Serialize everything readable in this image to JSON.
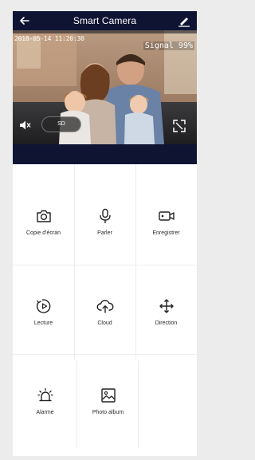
{
  "header": {
    "title": "Smart Camera",
    "back_icon": "back-arrow-icon",
    "edit_icon": "pencil-icon"
  },
  "video": {
    "timestamp": "2018-05-14 11:20:30",
    "signal": "Signal 99%",
    "sd_label": "SD",
    "speaker_icon": "speaker-icon",
    "fullscreen_icon": "fullscreen-icon"
  },
  "actions": {
    "screenshot": {
      "label": "Copie d'écran",
      "icon": "camera-icon"
    },
    "speak": {
      "label": "Parler",
      "icon": "microphone-icon"
    },
    "record": {
      "label": "Enregistrer",
      "icon": "video-camera-icon"
    },
    "playback": {
      "label": "Lecture",
      "icon": "playback-icon"
    },
    "cloud": {
      "label": "Cloud",
      "icon": "cloud-icon"
    },
    "direction": {
      "label": "Direction",
      "icon": "direction-arrows-icon"
    },
    "alarm": {
      "label": "Alarme",
      "icon": "alarm-icon"
    },
    "album": {
      "label": "Photo album",
      "icon": "photo-icon"
    }
  },
  "colors": {
    "header_bg": "#0f1433",
    "icon_color": "#222222"
  }
}
